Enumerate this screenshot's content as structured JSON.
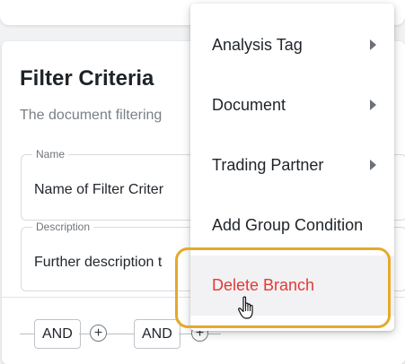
{
  "section": {
    "title": "Filter Criteria",
    "subtitle": "The document filtering"
  },
  "fields": {
    "name": {
      "label": "Name",
      "value": "Name of Filter Criter"
    },
    "description": {
      "label": "Description",
      "value": "Further description t"
    }
  },
  "logic": {
    "and_label_1": "AND",
    "and_label_2": "AND",
    "plus_symbol": "+"
  },
  "menu": {
    "items": [
      {
        "label": "Analysis Tag",
        "has_submenu": true
      },
      {
        "label": "Document",
        "has_submenu": true
      },
      {
        "label": "Trading Partner",
        "has_submenu": true
      },
      {
        "label": "Add Group Condition",
        "has_submenu": false
      },
      {
        "label": "Delete Branch",
        "has_submenu": false
      }
    ]
  },
  "colors": {
    "danger": "#e53935",
    "highlight": "#e6a92a"
  }
}
